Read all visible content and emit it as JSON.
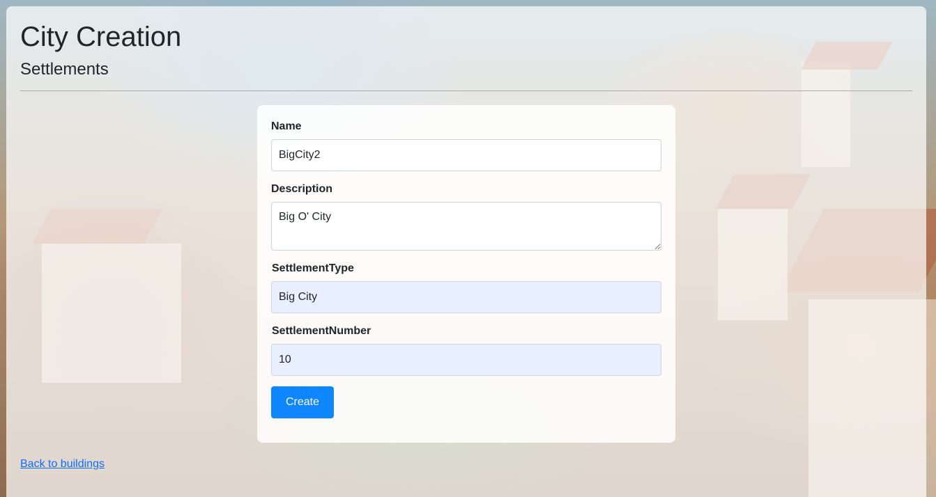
{
  "header": {
    "title": "City Creation",
    "subtitle": "Settlements"
  },
  "form": {
    "name": {
      "label": "Name",
      "value": "BigCity2"
    },
    "description": {
      "label": "Description",
      "value": "Big O' City"
    },
    "settlement_type": {
      "label": "SettlementType",
      "value": "Big City"
    },
    "settlement_number": {
      "label": "SettlementNumber",
      "value": "10"
    },
    "submit_label": "Create"
  },
  "footer": {
    "back_link": "Back to buildings"
  },
  "colors": {
    "accent": "#0d86ff",
    "link": "#0d6efd",
    "autofill_background": "#e8f0fe"
  }
}
